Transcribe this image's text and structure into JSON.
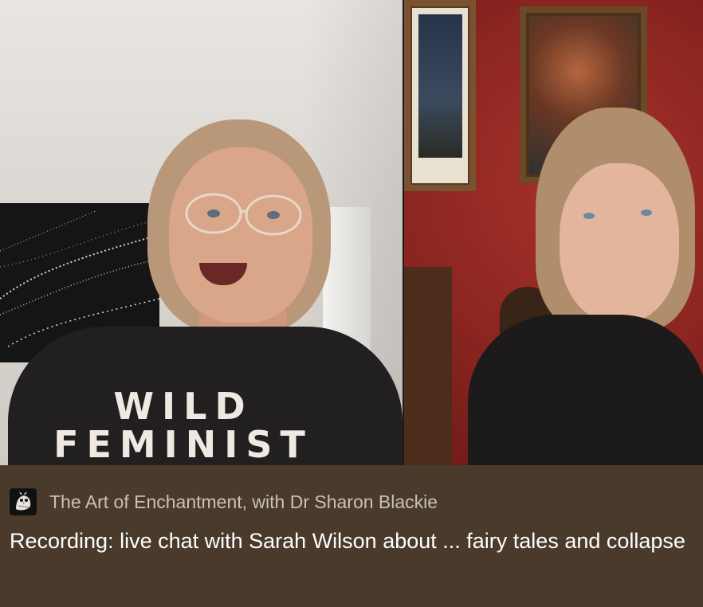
{
  "thumbnail": {
    "left_shirt_text_line1": "WILD",
    "left_shirt_text_line2": "FEMINIST",
    "icon": "video-still-icon"
  },
  "publication": {
    "logo_icon": "owl-bird-logo-icon",
    "name": "The Art of Enchantment, with Dr Sharon Blackie"
  },
  "post": {
    "title": "Recording: live chat with Sarah Wilson about ... fairy tales and collapse"
  },
  "colors": {
    "caption_background": "#4a3a2c",
    "title_text": "#ffffff",
    "publication_text": "#c8c1b8",
    "wallpaper_red": "#8a2520"
  }
}
